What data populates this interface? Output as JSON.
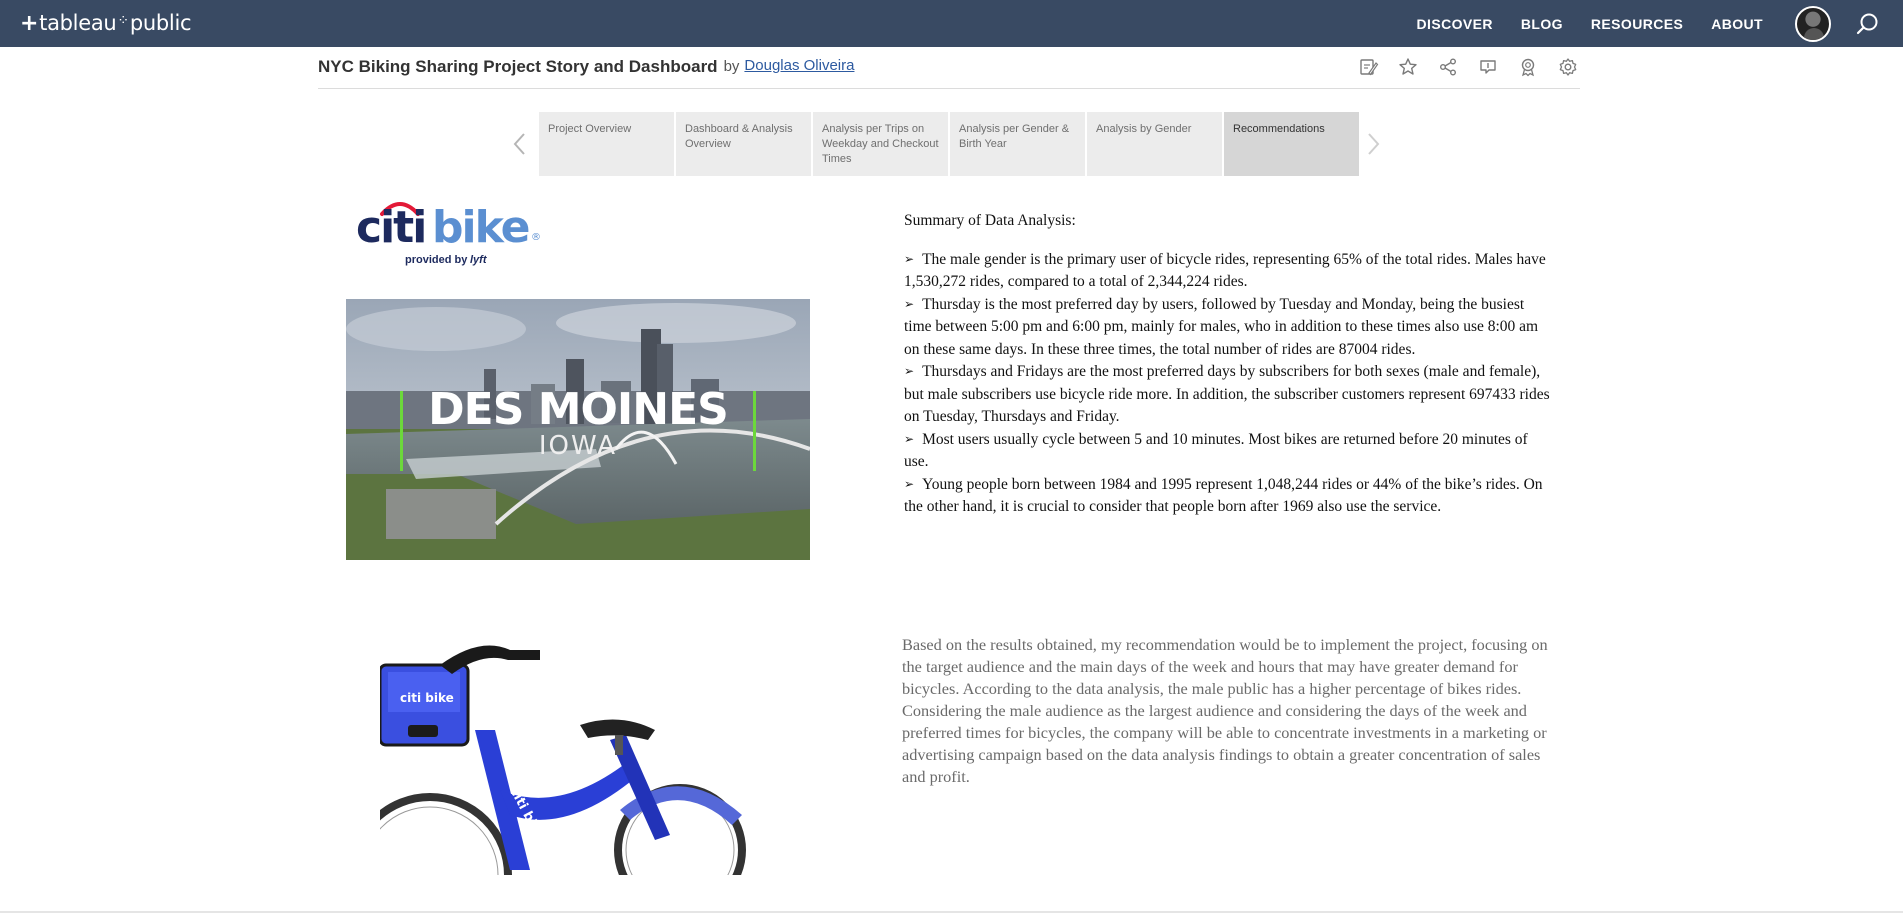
{
  "brand": {
    "name_left": "tableau",
    "name_right": "public"
  },
  "nav": {
    "items": [
      "DISCOVER",
      "BLOG",
      "RESOURCES",
      "ABOUT"
    ]
  },
  "viz": {
    "title": "NYC Biking Sharing Project Story and Dashboard",
    "by": "by",
    "author": "Douglas Oliveira"
  },
  "toolbar_icons": [
    "edit-icon",
    "favorite-star-icon",
    "share-icon",
    "comment-icon",
    "badge-icon",
    "settings-gear-icon"
  ],
  "story": {
    "tabs": [
      {
        "label": "Project Overview"
      },
      {
        "label": "Dashboard & Analysis Overview"
      },
      {
        "label": "Analysis per Trips on Weekday and Checkout Times"
      },
      {
        "label": "Analysis per Gender & Birth Year"
      },
      {
        "label": "Analysis by Gender"
      },
      {
        "label": "Recommendations"
      }
    ],
    "active_index": 5
  },
  "logo": {
    "word_a": "citi",
    "word_b": "bike",
    "registered": "®",
    "tagline": "provided by",
    "tagline_brand": "lyft"
  },
  "photo": {
    "city": "DES MOINES",
    "state": "IOWA"
  },
  "bike_photo": {
    "brand": "citi bike"
  },
  "summary": {
    "heading": "Summary of Data Analysis:",
    "bullets": [
      "The male gender is the primary user of bicycle rides, representing 65% of the total rides. Males have 1,530,272 rides, compared to a total of 2,344,224 rides.",
      "Thursday is the most preferred day by users, followed by Tuesday and Monday, being the busiest time between 5:00 pm and 6:00 pm, mainly for males, who in addition to these times also use 8:00 am on these same days. In these three times, the total number of rides are 87004 rides.",
      "Thursdays and Fridays are the most preferred days by subscribers for both sexes (male and female), but male subscribers use bicycle ride more. In addition, the subscriber customers represent 697433 rides on Tuesday, Thursdays and Friday.",
      "Most users usually cycle between 5 and 10 minutes. Most bikes are returned before 20 minutes of use.",
      "Young people born between 1984 and 1995 represent 1,048,244 rides or 44% of the bike’s rides. On the other hand, it is crucial to consider that people born after 1969 also use the service."
    ]
  },
  "recommendation": "Based on the results obtained, my recommendation would be to implement the project, focusing on the target audience and the main days of the week and hours that may have greater demand for bicycles. According to the data analysis, the male public has a higher percentage of bikes rides. Considering the male audience as the largest audience and considering the days of the week and preferred times for bicycles, the company will be able to concentrate investments in a marketing or advertising campaign based on the data analysis findings to obtain a greater concentration of sales and profit.",
  "colors": {
    "nav_bg": "#394a63",
    "tab_bg": "#ececec",
    "tab_active_bg": "#d6d6d6",
    "link": "#2d5aa0",
    "citi_navy": "#1d2a5e",
    "citi_blue": "#5b8fd1",
    "citi_red": "#e31937",
    "bike_blue": "#2a3fd6"
  }
}
